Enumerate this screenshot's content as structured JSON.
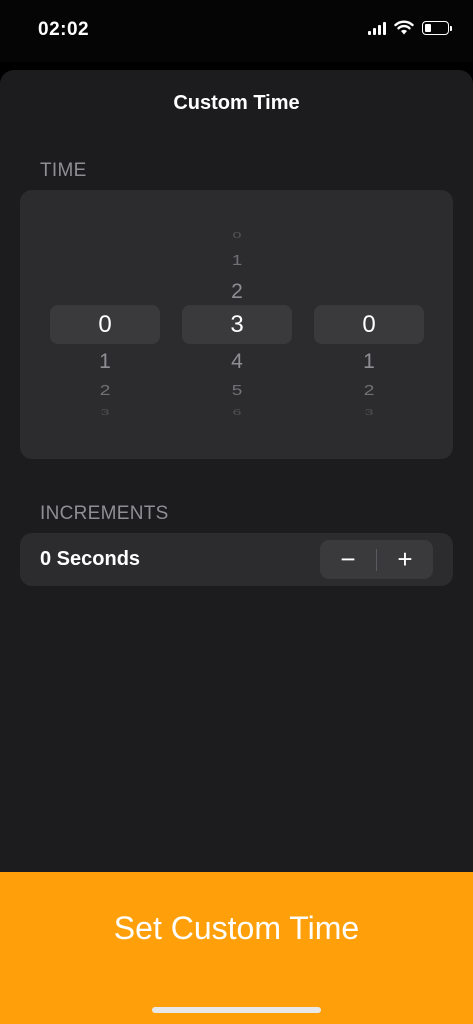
{
  "status_bar": {
    "time": "02:02",
    "icons": [
      "cellular-signal-icon",
      "wifi-icon",
      "battery-icon"
    ],
    "battery_level": 0.3
  },
  "sheet": {
    "title": "Custom Time"
  },
  "time_section": {
    "label": "TIME",
    "pickers": [
      {
        "name": "hours",
        "above": [],
        "selected": "0",
        "below": [
          "1",
          "2",
          "3"
        ]
      },
      {
        "name": "minutes",
        "above": [
          "0",
          "1",
          "2"
        ],
        "selected": "3",
        "below": [
          "4",
          "5",
          "6"
        ]
      },
      {
        "name": "seconds",
        "above": [],
        "selected": "0",
        "below": [
          "1",
          "2",
          "3"
        ]
      }
    ]
  },
  "increments_section": {
    "label": "INCREMENTS",
    "value": "0 Seconds",
    "decrement_symbol": "−",
    "increment_symbol": "+"
  },
  "cta": {
    "label": "Set Custom Time"
  },
  "colors": {
    "accent": "#ffa00a",
    "sheet_bg": "#1c1c1e",
    "card_bg": "#2c2c2e"
  }
}
